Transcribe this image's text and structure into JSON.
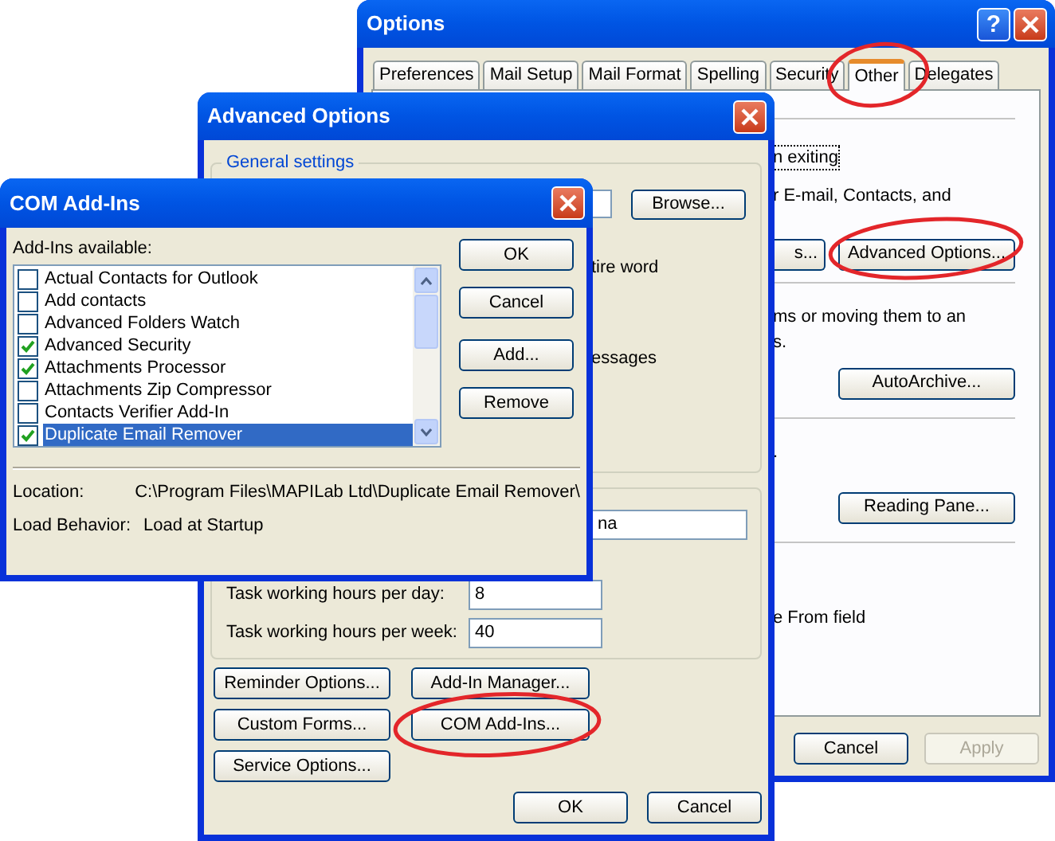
{
  "options_window": {
    "title": "Options",
    "help_button": "?",
    "tabs": [
      {
        "label": "Preferences",
        "selected": false
      },
      {
        "label": "Mail Setup",
        "selected": false
      },
      {
        "label": "Mail Format",
        "selected": false
      },
      {
        "label": "Spelling",
        "selected": false
      },
      {
        "label": "Security",
        "selected": false
      },
      {
        "label": "Other",
        "selected": true
      },
      {
        "label": "Delegates",
        "selected": false
      }
    ],
    "sections": [
      {
        "texts": [
          {
            "text": "n exiting",
            "focused": true
          },
          {
            "text": "r E-mail, Contacts, and",
            "focused": false
          }
        ],
        "buttons": [
          {
            "label": "s...",
            "clipped": true
          },
          {
            "label": "Advanced Options...",
            "clipped": false
          }
        ]
      },
      {
        "texts": [
          {
            "text": "ms or moving them to an",
            "focused": false
          },
          {
            "text": "s.",
            "focused": false
          }
        ],
        "buttons": [
          {
            "label": "AutoArchive...",
            "clipped": false
          }
        ]
      },
      {
        "texts": [
          {
            "text": ".",
            "focused": false
          }
        ],
        "buttons": [
          {
            "label": "Reading Pane...",
            "clipped": false
          }
        ]
      },
      {
        "texts": [
          {
            "text": "e From field",
            "focused": false
          }
        ]
      }
    ],
    "footer_buttons": [
      {
        "label": "Cancel",
        "disabled": false
      },
      {
        "label": "Apply",
        "disabled": true
      }
    ]
  },
  "advanced_window": {
    "title": "Advanced Options",
    "general_group": {
      "legend": "General settings",
      "browse_button": "Browse...",
      "texts": [
        "tire word",
        "essages"
      ]
    },
    "second_group": {
      "field_value": "na",
      "task_rows": [
        {
          "label": "Task working hours per day:",
          "value": "8"
        },
        {
          "label": "Task working hours per week:",
          "value": "40"
        }
      ]
    },
    "buttons": [
      "Reminder Options...",
      "Add-In Manager...",
      "Custom Forms...",
      "COM Add-Ins...",
      "Service Options..."
    ],
    "footer_buttons": [
      "OK",
      "Cancel"
    ]
  },
  "com_window": {
    "title": "COM Add-Ins",
    "list_label": "Add-Ins available:",
    "items": [
      {
        "label": "Actual Contacts for Outlook",
        "checked": false,
        "selected": false
      },
      {
        "label": "Add contacts",
        "checked": false,
        "selected": false
      },
      {
        "label": "Advanced Folders Watch",
        "checked": false,
        "selected": false
      },
      {
        "label": "Advanced Security",
        "checked": true,
        "selected": false
      },
      {
        "label": "Attachments Processor",
        "checked": true,
        "selected": false
      },
      {
        "label": "Attachments Zip Compressor",
        "checked": false,
        "selected": false
      },
      {
        "label": "Contacts Verifier Add-In",
        "checked": false,
        "selected": false
      },
      {
        "label": "Duplicate Email Remover",
        "checked": true,
        "selected": true
      }
    ],
    "buttons": [
      "OK",
      "Cancel",
      "Add...",
      "Remove"
    ],
    "details": [
      {
        "label": "Location:",
        "value": "C:\\Program Files\\MAPILab Ltd\\Duplicate Email Remover\\"
      },
      {
        "label": "Load Behavior:",
        "value": "Load at Startup"
      }
    ]
  }
}
